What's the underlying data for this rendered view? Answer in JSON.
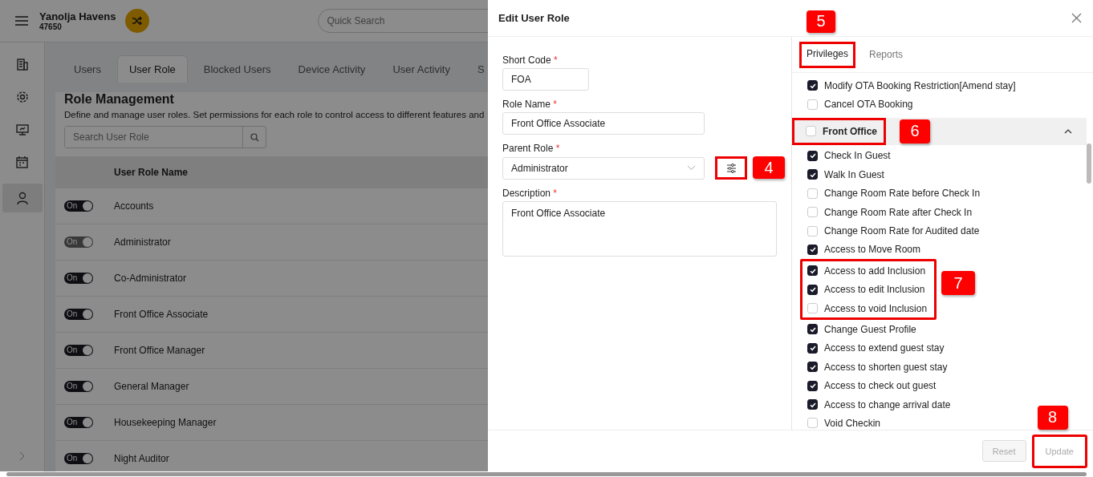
{
  "app": {
    "hotel_name": "Yanolja Havens",
    "hotel_code": "47650",
    "search": {
      "placeholder": "Quick Search"
    }
  },
  "sidebar": {
    "items": [
      {
        "selected": false
      },
      {
        "selected": false
      },
      {
        "selected": false
      },
      {
        "selected": false
      },
      {
        "selected": true
      }
    ]
  },
  "tabs": [
    {
      "label": "Users",
      "selected": false
    },
    {
      "label": "User Role",
      "selected": true
    },
    {
      "label": "Blocked Users",
      "selected": false
    },
    {
      "label": "Device Activity",
      "selected": false
    },
    {
      "label": "User Activity",
      "selected": false
    },
    {
      "label": "S",
      "selected": false
    }
  ],
  "role_management": {
    "title": "Role Management",
    "description": "Define and manage user roles. Set permissions for each role to control access to different features and",
    "search": {
      "placeholder": "Search User Role"
    },
    "table": {
      "columns": [
        "User Role Name"
      ],
      "rows": [
        {
          "toggle": "On",
          "on": true,
          "disabled": false,
          "name": "Accounts"
        },
        {
          "toggle": "On",
          "on": true,
          "disabled": true,
          "name": "Administrator"
        },
        {
          "toggle": "On",
          "on": true,
          "disabled": false,
          "name": "Co-Administrator"
        },
        {
          "toggle": "On",
          "on": true,
          "disabled": false,
          "name": "Front Office Associate"
        },
        {
          "toggle": "On",
          "on": true,
          "disabled": false,
          "name": "Front Office Manager"
        },
        {
          "toggle": "On",
          "on": true,
          "disabled": false,
          "name": "General Manager"
        },
        {
          "toggle": "On",
          "on": true,
          "disabled": false,
          "name": "Housekeeping Manager"
        },
        {
          "toggle": "On",
          "on": true,
          "disabled": false,
          "name": "Night Auditor"
        }
      ]
    }
  },
  "dialog": {
    "title": "Edit User Role",
    "fields": [
      {
        "kind": "input",
        "label": "Short Code",
        "required_mark": "*",
        "value": "FOA"
      },
      {
        "kind": "input",
        "label": "Role Name",
        "required_mark": "*",
        "value": "Front Office Associate"
      },
      {
        "kind": "select",
        "label": "Parent Role",
        "required_mark": "*",
        "value": "Administrator",
        "callout": "4"
      },
      {
        "kind": "textarea",
        "label": "Description",
        "required_mark": "*",
        "value": "Front Office Associate"
      }
    ],
    "tabs": [
      {
        "label": "Privileges",
        "selected": true,
        "callout": "5"
      },
      {
        "label": "Reports",
        "selected": false
      }
    ],
    "privileges": [
      {
        "kind": "item",
        "label": "Modify OTA Booking Restriction[Amend stay]",
        "checked": true
      },
      {
        "kind": "item",
        "label": "Cancel OTA Booking",
        "checked": false
      },
      {
        "kind": "group",
        "label": "Front Office",
        "checked": false,
        "expanded": true,
        "callout": "6",
        "children": [
          {
            "kind": "item",
            "label": "Check In Guest",
            "checked": true
          },
          {
            "kind": "item",
            "label": "Walk In Guest",
            "checked": true
          },
          {
            "kind": "item",
            "label": "Change Room Rate before Check In",
            "checked": false
          },
          {
            "kind": "item",
            "label": "Change Room Rate after Check In",
            "checked": false
          },
          {
            "kind": "item",
            "label": "Change Room Rate for Audited date",
            "checked": false
          },
          {
            "kind": "item",
            "label": "Access to Move Room",
            "checked": true
          },
          {
            "kind": "callout",
            "number": "7",
            "children": [
              {
                "kind": "item",
                "label": "Access to add Inclusion",
                "checked": true
              },
              {
                "kind": "item",
                "label": "Access to edit Inclusion",
                "checked": true
              },
              {
                "kind": "item",
                "label": "Access to void Inclusion",
                "checked": false
              }
            ]
          },
          {
            "kind": "item",
            "label": "Change Guest Profile",
            "checked": true
          },
          {
            "kind": "item",
            "label": "Access to extend guest stay",
            "checked": true
          },
          {
            "kind": "item",
            "label": "Access to shorten guest stay",
            "checked": true
          },
          {
            "kind": "item",
            "label": "Access to check out guest",
            "checked": true
          },
          {
            "kind": "item",
            "label": "Access to change arrival date",
            "checked": true
          },
          {
            "kind": "item",
            "label": "Void Checkin",
            "checked": false
          }
        ]
      }
    ],
    "buttons": [
      {
        "label": "Reset",
        "disabled": true
      },
      {
        "label": "Update",
        "disabled": true,
        "callout": "8"
      }
    ]
  }
}
